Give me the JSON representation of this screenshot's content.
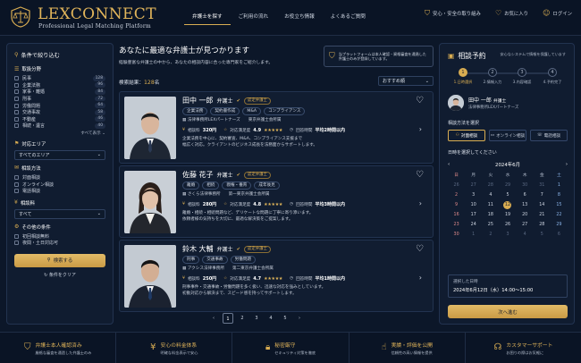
{
  "brand": {
    "name": "LEXCONNECT",
    "tagline": "Professional Legal Matching Platform"
  },
  "nav": [
    "弁護士を探す",
    "ご利用の流れ",
    "お役立ち情報",
    "よくあるご質問"
  ],
  "header_links": [
    {
      "label": "安心・安全の取り組み",
      "icon": "shield-icon"
    },
    {
      "label": "お気に入り",
      "icon": "heart-icon"
    },
    {
      "label": "ログイン",
      "icon": "user-icon"
    }
  ],
  "filters": {
    "title": "条件で絞り込む",
    "field_title": "取扱分野",
    "fields": [
      {
        "label": "民事",
        "count": "128"
      },
      {
        "label": "企業法務",
        "count": "96"
      },
      {
        "label": "家事・離婚",
        "count": "84"
      },
      {
        "label": "刑事",
        "count": "72"
      },
      {
        "label": "労働問題",
        "count": "64"
      },
      {
        "label": "交通事故",
        "count": "58"
      },
      {
        "label": "不動産",
        "count": "46"
      },
      {
        "label": "相続・遺言",
        "count": "40"
      }
    ],
    "more": "すべて表示",
    "area_title": "対応エリア",
    "area_value": "すべてのエリア",
    "method_title": "相談方法",
    "methods": [
      "対面相談",
      "オンライン相談",
      "電話相談"
    ],
    "fee_title": "相談料",
    "fee_value": "すべて",
    "other_title": "その他の条件",
    "others": [
      "初回相談無料",
      "夜間・土日対応可"
    ],
    "search_label": "検索する",
    "clear_label": "条件をクリア"
  },
  "main": {
    "title": "あなたに最適な弁護士が見つかります",
    "subtitle": "経験豊富な弁護士の中から、あなたの相談内容に合った専門家をご紹介します。",
    "safety_note": [
      "当プラットフォームは本人確認・資格審査を通過した",
      "弁護士のみが登録しています。"
    ],
    "result_label": "検索結果：",
    "result_count": "128",
    "result_unit": "名",
    "sort_label": "おすすめ順",
    "labels": {
      "fee": "相談料",
      "rating": "対応満足度",
      "response": "回答時間"
    },
    "lawyers": [
      {
        "name": "田中 一郎",
        "role": "弁護士",
        "badge": "認定弁護士",
        "tags": [
          "企業法務",
          "契約書作成",
          "M&A",
          "コンプライアンス"
        ],
        "firm": "法律事務所LEXパートナーズ",
        "bar": "東京弁護士会所属",
        "fee": "320円",
        "rating": "4.9",
        "stars": "★★★★★",
        "response": "平均2時間以内",
        "desc": [
          "企業法務を中心に、契約審査、M&A、コンプライアンス支援まで",
          "幅広く対応。クライアントのビジネス成長を法務面からサポートします。"
        ]
      },
      {
        "name": "佐藤 花子",
        "role": "弁護士",
        "badge": "認定弁護士",
        "tags": [
          "離婚",
          "相続",
          "親権・養育",
          "成年後見"
        ],
        "firm": "さくら法律事務所",
        "bar": "第一東京弁護士会所属",
        "fee": "280円",
        "rating": "4.8",
        "stars": "★★★★★",
        "response": "平均3時間以内",
        "desc": [
          "離婚・相続・相続問題など、デリケートな問題に丁寧に寄り添います。",
          "依頼者様の気持ちを大切に、最適な解決策をご提案します。"
        ]
      },
      {
        "name": "鈴木 大輔",
        "role": "弁護士",
        "badge": "認定弁護士",
        "tags": [
          "刑事",
          "交通事故",
          "労働問題"
        ],
        "firm": "アクシス法律事務所",
        "bar": "第二東京弁護士会所属",
        "fee": "250円",
        "rating": "4.7",
        "stars": "★★★★★",
        "response": "平均1時間以内",
        "desc": [
          "刑事事件・交通事故・労働問題を多く扱い、迅速な対応を強みとしています。",
          "初動対応から解決まで、スピード感を持ってサポートします。"
        ]
      }
    ],
    "pages": [
      "1",
      "2",
      "3",
      "4",
      "5"
    ]
  },
  "booking": {
    "title": "相談予約",
    "note": "安心なシステムで情報を保護しています",
    "steps": [
      {
        "num": "1",
        "label": "1.日時選択"
      },
      {
        "num": "2",
        "label": "2.情報入力"
      },
      {
        "num": "3",
        "label": "3.内容確認"
      },
      {
        "num": "4",
        "label": "4.予約完了"
      }
    ],
    "lawyer_name": "田中 一郎",
    "lawyer_role": "弁護士",
    "lawyer_firm": "法律事務所LEXパートナーズ",
    "method_label": "相談方法を選択",
    "methods": [
      "対面相談",
      "オンライン相談",
      "電話相談"
    ],
    "date_label": "日時を選択してください",
    "month": "2024年6月",
    "dow": [
      "日",
      "月",
      "火",
      "水",
      "木",
      "金",
      "土"
    ],
    "weeks": [
      [
        "26",
        "27",
        "28",
        "29",
        "30",
        "31",
        "1"
      ],
      [
        "2",
        "3",
        "4",
        "5",
        "6",
        "7",
        "8"
      ],
      [
        "9",
        "10",
        "11",
        "12",
        "13",
        "14",
        "15"
      ],
      [
        "16",
        "17",
        "18",
        "19",
        "20",
        "21",
        "22"
      ],
      [
        "23",
        "24",
        "25",
        "26",
        "27",
        "28",
        "29"
      ],
      [
        "30",
        "1",
        "2",
        "3",
        "4",
        "5",
        "6"
      ]
    ],
    "selected_day": "12",
    "selected_label": "選択した日時",
    "selected_value": "2024年6月12日（水）14:00〜15:00",
    "next_label": "次へ進む"
  },
  "footer": [
    {
      "title": "弁護士本人確認済み",
      "sub": "厳格な審査を通過した弁護士のみ",
      "icon": "shield-check-icon"
    },
    {
      "title": "安心の料金体系",
      "sub": "明確な料金表示で安心",
      "icon": "yen-icon"
    },
    {
      "title": "秘密厳守",
      "sub": "セキュリティ対策を徹底",
      "icon": "lock-icon"
    },
    {
      "title": "実績・評価を公開",
      "sub": "信頼性の高い情報を提供",
      "icon": "thumbs-up-icon"
    },
    {
      "title": "カスタマーサポート",
      "sub": "お困りの際はお気軽に",
      "icon": "headset-icon"
    }
  ]
}
